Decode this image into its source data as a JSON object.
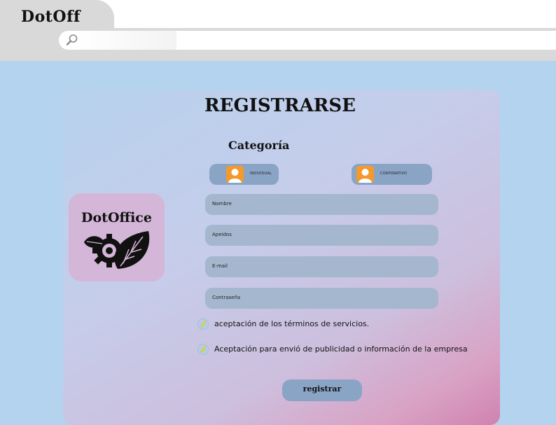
{
  "browser": {
    "tab_title": "DotOff",
    "address_value": "",
    "search_icon": "magnifier-icon"
  },
  "form": {
    "title": "REGISTRARSE",
    "category_heading": "Categoría",
    "categories": [
      {
        "label": "INDIVIDUAL",
        "icon": "user-avatar-icon",
        "color": "#f29a2e"
      },
      {
        "label": "CORPORATIVO",
        "icon": "user-avatar-icon",
        "color": "#f29a2e"
      }
    ],
    "fields": [
      {
        "placeholder": "Nombre"
      },
      {
        "placeholder": "Apeidos"
      },
      {
        "placeholder": "E-mail"
      },
      {
        "placeholder": "Contraseña"
      }
    ],
    "checkboxes": [
      {
        "label": "aceptación de los términos de servicios."
      },
      {
        "label": "Aceptación para envió de publicidad o información de la empresa"
      }
    ],
    "submit_label": "registrar"
  },
  "brand": {
    "logo_text": "DotOffice",
    "logo_icon": "gear-leaf-logo"
  },
  "colors": {
    "page_bg": "#b3d3ef",
    "button": "#8aa4c6",
    "field": "#a5b7cf",
    "logo_card": "#d4b6d8",
    "avatar": "#f29a2e"
  }
}
